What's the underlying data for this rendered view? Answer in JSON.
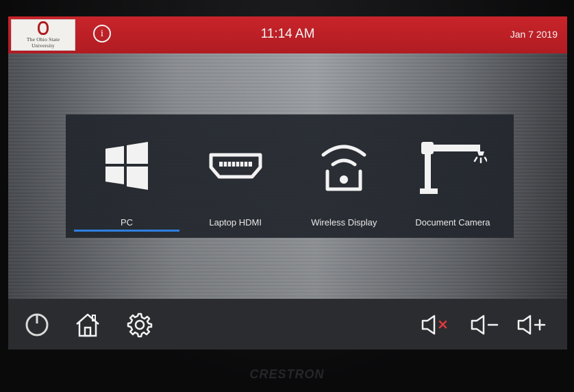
{
  "header": {
    "logo_text": "The Ohio State\nUniversity",
    "info_label": "i",
    "time": "11:14 AM",
    "date": "Jan 7 2019"
  },
  "sources": [
    {
      "label": "PC",
      "icon": "windows-icon",
      "selected": true
    },
    {
      "label": "Laptop HDMI",
      "icon": "hdmi-icon",
      "selected": false
    },
    {
      "label": "Wireless Display",
      "icon": "wireless-display-icon",
      "selected": false
    },
    {
      "label": "Document Camera",
      "icon": "document-camera-icon",
      "selected": false
    }
  ],
  "bottom_bar": {
    "left_buttons": [
      "power-icon",
      "home-icon",
      "settings-icon"
    ],
    "right_buttons": [
      "volume-mute-icon",
      "volume-down-icon",
      "volume-up-icon"
    ]
  },
  "hardware": {
    "brand": "CRESTRON"
  },
  "colors": {
    "header_red": "#b01c22",
    "selected_underline": "#2e7fe0",
    "mute_red": "#e0393e",
    "icon_white": "#f2f2f2"
  }
}
